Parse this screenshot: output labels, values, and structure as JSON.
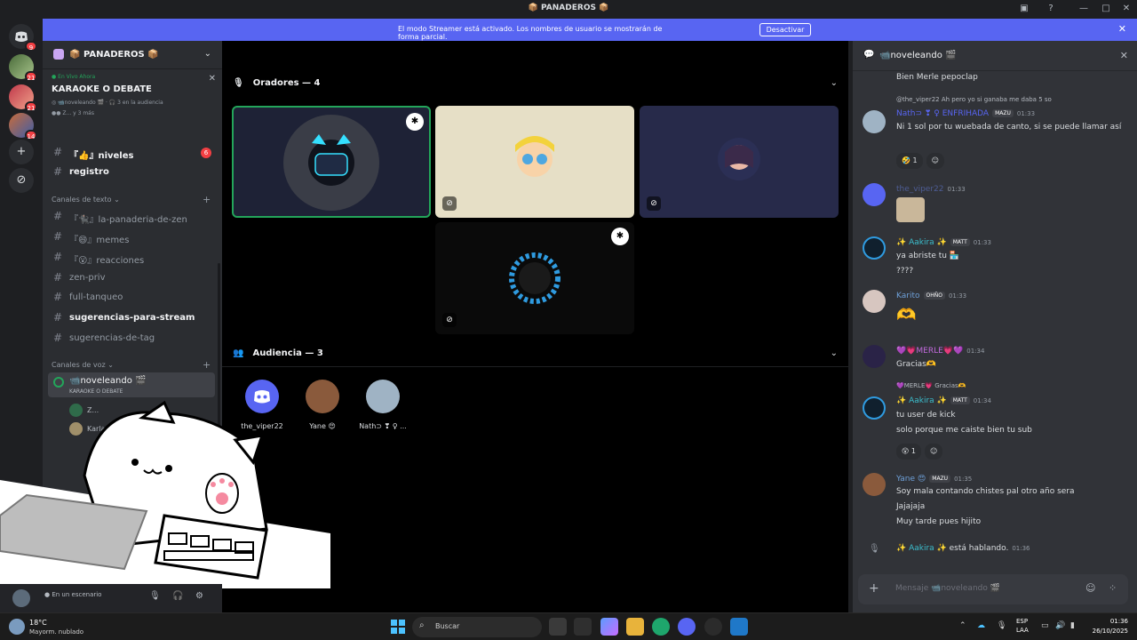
{
  "window": {
    "title": "PANADEROS",
    "controls": [
      "inbox-icon",
      "help-icon",
      "minimize",
      "maximize",
      "close"
    ]
  },
  "banner": {
    "message": "El modo Streamer está activado. Los nombres de usuario se mostrarán de forma parcial.",
    "button": "Desactivar"
  },
  "rail": {
    "servers": [
      {
        "name": "direct-messages",
        "badge": "9"
      },
      {
        "name": "server-1",
        "badge": "21"
      },
      {
        "name": "server-2",
        "badge": "21"
      },
      {
        "name": "server-3",
        "badge": "14"
      }
    ]
  },
  "sidebar": {
    "server_name": "PANADEROS",
    "live_tag": "En Vivo Ahora",
    "live_title": "KARAOKE O DEBATE",
    "live_channel": "noveleando",
    "live_audience": "3 en la audiencia",
    "live_speakers": "Z... y 3 más",
    "channels_top": [
      {
        "label": "『👍』niveles",
        "badge": "6",
        "unread": true
      },
      {
        "label": "registro",
        "unread": true
      }
    ],
    "text_category": "Canales de texto",
    "text_channels": [
      {
        "label": "『🐈‍⬛』la-panaderia-de-zen",
        "unread": false
      },
      {
        "label": "『😄』memes",
        "unread": false
      },
      {
        "label": "『😮』reacciones",
        "unread": false
      },
      {
        "label": "zen-priv",
        "unread": false
      },
      {
        "label": "full-tanqueo",
        "unread": false
      },
      {
        "label": "sugerencias-para-stream",
        "unread": true
      },
      {
        "label": "sugerencias-de-tag",
        "unread": false
      }
    ],
    "voice_category": "Canales de voz",
    "voice_channel": "noveleando",
    "voice_subtitle": "KARAOKE O DEBATE",
    "voice_users": [
      "Z...",
      "Karla M"
    ],
    "user_status": "En un escenario"
  },
  "stage": {
    "speakers_header": "Oradores — 4",
    "audience_header": "Audiencia — 3",
    "audience": [
      {
        "name": "the_viper22",
        "color": "#5865f2"
      },
      {
        "name": "Yane 😍",
        "color": "#8a5a3c"
      },
      {
        "name": "Nath⊃ ❣ ♀ ...",
        "color": "#9fb3c4"
      }
    ]
  },
  "chat": {
    "channel": "noveleando",
    "input_placeholder": "Mensaje 📹noveleando 🎬",
    "messages": [
      {
        "id": "m0",
        "text": "Bien Merle pepoclap"
      },
      {
        "id": "m1",
        "reply": "@the_viper22  Ah pero yo si ganaba me daba 5 so",
        "author": "Nath⊃ ❣ ♀ ENFRIHADA",
        "tag": "MAZU",
        "time": "01:33",
        "text": "Ni 1 sol por tu wuebada de canto, si se puede llamar así",
        "reaction": "🤣 1",
        "author_color": "#5865f2"
      },
      {
        "id": "m2",
        "author": "the_viper22",
        "time": "01:33",
        "author_color": "#4e5d94"
      },
      {
        "id": "m3",
        "author": "✨ Aakira ✨",
        "tag": "MATT",
        "time": "01:33",
        "text": "ya abriste tu 🏪",
        "text2": "????",
        "author_color": "#3bbdcc"
      },
      {
        "id": "m4",
        "author": "Karito",
        "tag": "OHÑO",
        "time": "01:33",
        "author_color": "#6ea0d8"
      },
      {
        "id": "m5",
        "author": "💜💗MERLE💗💜",
        "time": "01:34",
        "text": "Gracias🫶",
        "author_color": "#c16adb"
      },
      {
        "id": "m6",
        "reply": "💜MERLE💗 Gracias🫶",
        "author": "✨ Aakira ✨",
        "tag": "MATT",
        "time": "01:34",
        "text": "tu user de kick",
        "text2": "solo porque me caiste bien tu sub",
        "reaction": "😲 1",
        "author_color": "#3bbdcc"
      },
      {
        "id": "m7",
        "author": "Yane 😍",
        "tag": "MAZU",
        "time": "01:35",
        "text": "Soy mala contando chistes pal otro año sera",
        "text2": "Jajajaja",
        "text3": "Muy tarde pues hijito",
        "author_color": "#6ea0d8"
      },
      {
        "id": "m8",
        "author": "✨ Aakira ✨",
        "text": "está hablando.",
        "time": "01:36",
        "author_color": "#3bbdcc"
      }
    ]
  },
  "taskbar": {
    "weather_temp": "18°C",
    "weather_desc": "Mayorm. nublado",
    "search_label": "Buscar",
    "lang": "ESP",
    "lang2": "LAA",
    "time": "01:36",
    "date": "26/10/2025"
  }
}
